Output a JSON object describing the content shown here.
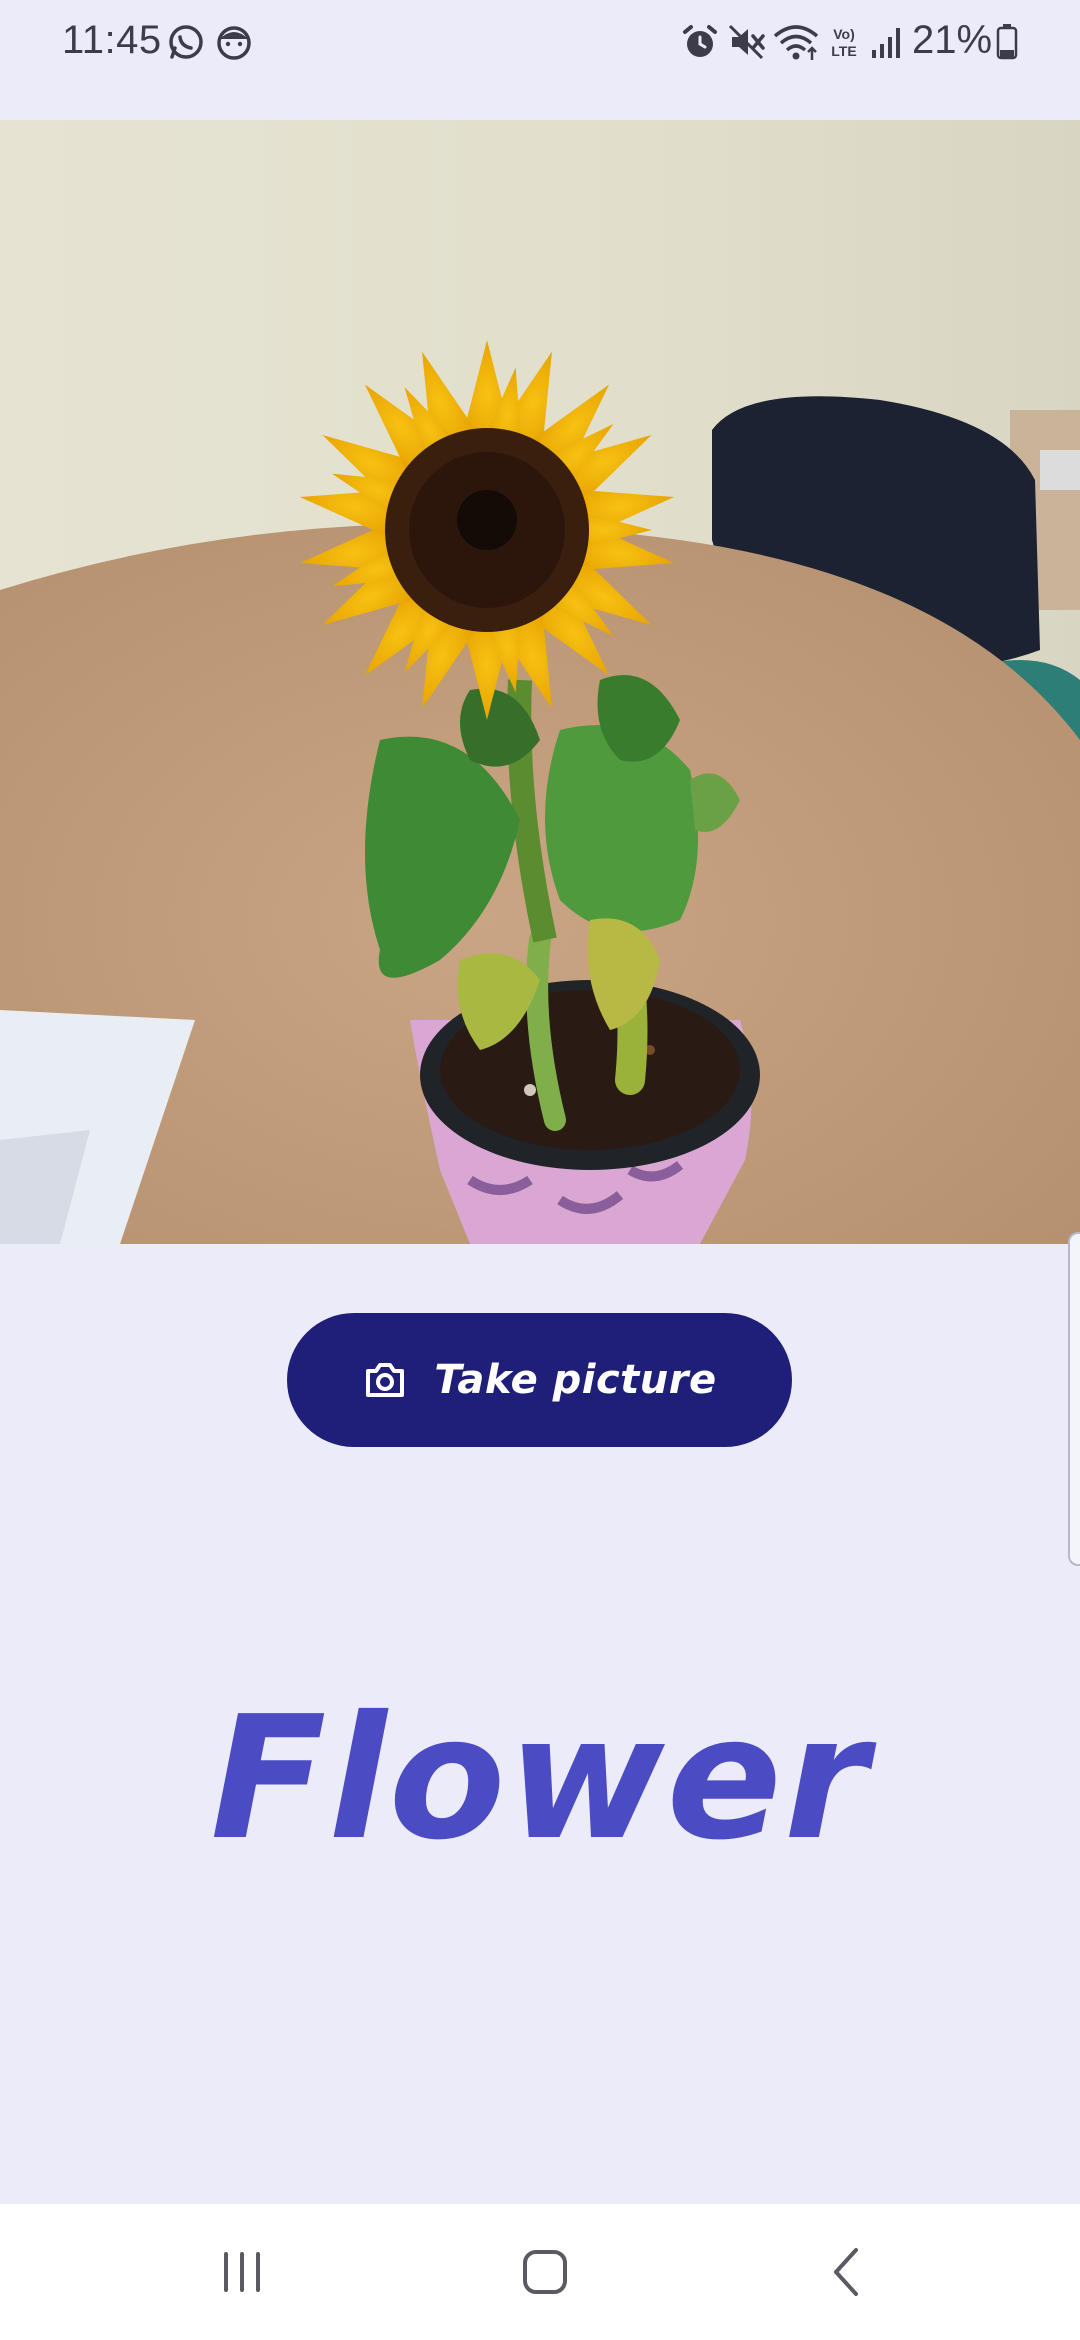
{
  "status_bar": {
    "time": "11:45",
    "battery": "21%",
    "icons": [
      "whatsapp-icon",
      "face-icon",
      "alarm-icon",
      "mute-icon",
      "wifi-icon",
      "volte-icon",
      "signal-icon",
      "battery-icon"
    ]
  },
  "photo": {
    "subject": "sunflower-photo"
  },
  "actions": {
    "take_picture_label": "Take picture",
    "icon": "camera-icon"
  },
  "result": {
    "label": "Flower"
  },
  "nav_bar": {
    "items": [
      "recent-apps-button",
      "home-button",
      "back-button"
    ]
  },
  "colors": {
    "background": "#ecebfa",
    "button": "#1f1f7a",
    "result_text": "#4b4bc4"
  }
}
